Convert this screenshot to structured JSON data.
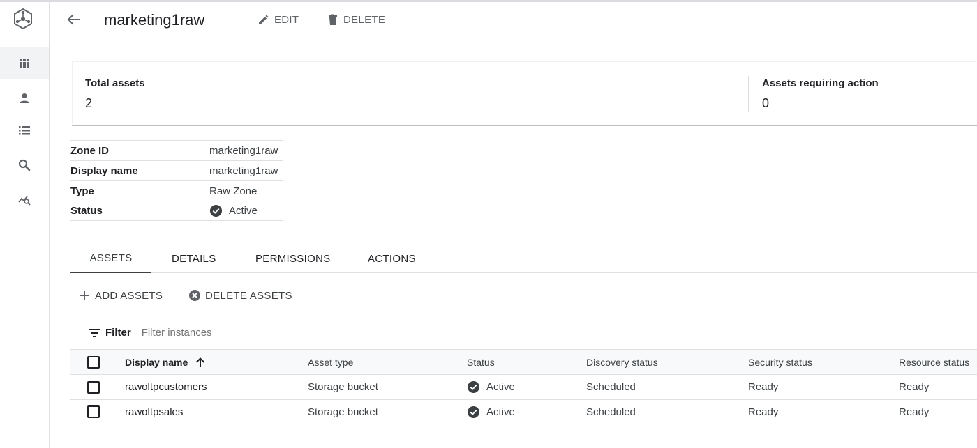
{
  "header": {
    "title": "marketing1raw",
    "edit_label": "EDIT",
    "delete_label": "DELETE"
  },
  "summary": {
    "total_assets_label": "Total assets",
    "total_assets_value": "2",
    "assets_requiring_action_label": "Assets requiring action",
    "assets_requiring_action_value": "0"
  },
  "properties": [
    {
      "key": "Zone ID",
      "value": "marketing1raw"
    },
    {
      "key": "Display name",
      "value": "marketing1raw"
    },
    {
      "key": "Type",
      "value": "Raw Zone"
    },
    {
      "key": "Status",
      "value": "Active"
    }
  ],
  "tabs": [
    {
      "label": "ASSETS",
      "active": true
    },
    {
      "label": "DETAILS",
      "active": false
    },
    {
      "label": "PERMISSIONS",
      "active": false
    },
    {
      "label": "ACTIONS",
      "active": false
    }
  ],
  "actions": {
    "add_assets_label": "ADD ASSETS",
    "delete_assets_label": "DELETE ASSETS"
  },
  "filter": {
    "label": "Filter",
    "placeholder": "Filter instances"
  },
  "table": {
    "columns": [
      "Display name",
      "Asset type",
      "Status",
      "Discovery status",
      "Security status",
      "Resource status"
    ],
    "sort_column": "Display name",
    "sort_direction": "ascending",
    "rows": [
      {
        "name": "rawoltpcustomers",
        "type": "Storage bucket",
        "status": "Active",
        "discovery": "Scheduled",
        "security": "Ready",
        "resource": "Ready"
      },
      {
        "name": "rawoltpsales",
        "type": "Storage bucket",
        "status": "Active",
        "discovery": "Scheduled",
        "security": "Ready",
        "resource": "Ready"
      }
    ]
  },
  "icons": {
    "rail": [
      "product-logo-icon",
      "grid-icon",
      "person-icon",
      "list-icon",
      "search-icon",
      "analytics-search-icon"
    ],
    "status_active": "check-circle-icon"
  },
  "colors": {
    "icon_gray": "#5f6368",
    "status_check": "#3c4043",
    "text": "#202124"
  }
}
